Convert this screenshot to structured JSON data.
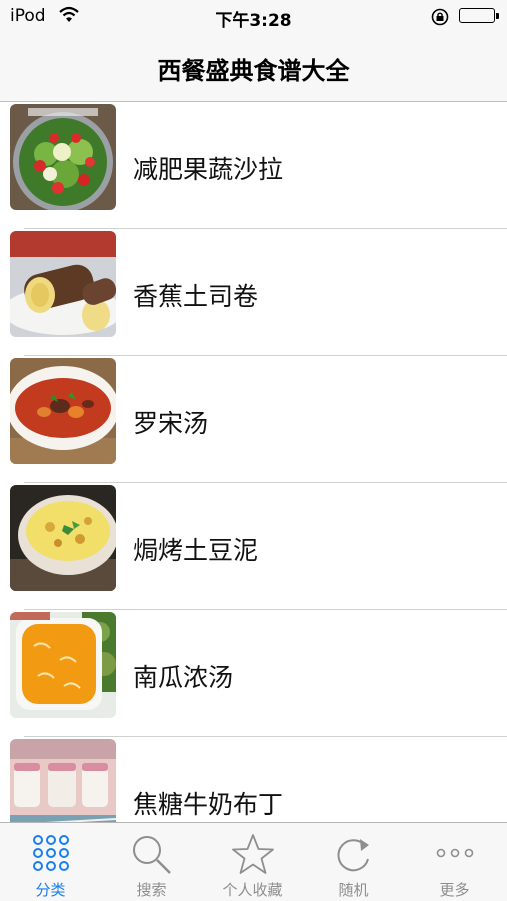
{
  "status_bar": {
    "carrier": "iPod",
    "time": "下午3:28"
  },
  "nav": {
    "title": "西餐盛典食谱大全"
  },
  "recipes": [
    {
      "name": "减肥果蔬沙拉"
    },
    {
      "name": "香蕉土司卷"
    },
    {
      "name": "罗宋汤"
    },
    {
      "name": "焗烤土豆泥"
    },
    {
      "name": "南瓜浓汤"
    },
    {
      "name": "焦糖牛奶布丁"
    }
  ],
  "tabbar": {
    "active_color": "#1a7ef0",
    "inactive_color": "#8e8e8e",
    "items": [
      {
        "label": "分类",
        "icon": "grid-dots-icon",
        "active": true
      },
      {
        "label": "搜索",
        "icon": "search-icon",
        "active": false
      },
      {
        "label": "个人收藏",
        "icon": "star-icon",
        "active": false
      },
      {
        "label": "随机",
        "icon": "refresh-icon",
        "active": false
      },
      {
        "label": "更多",
        "icon": "more-icon",
        "active": false
      }
    ]
  }
}
